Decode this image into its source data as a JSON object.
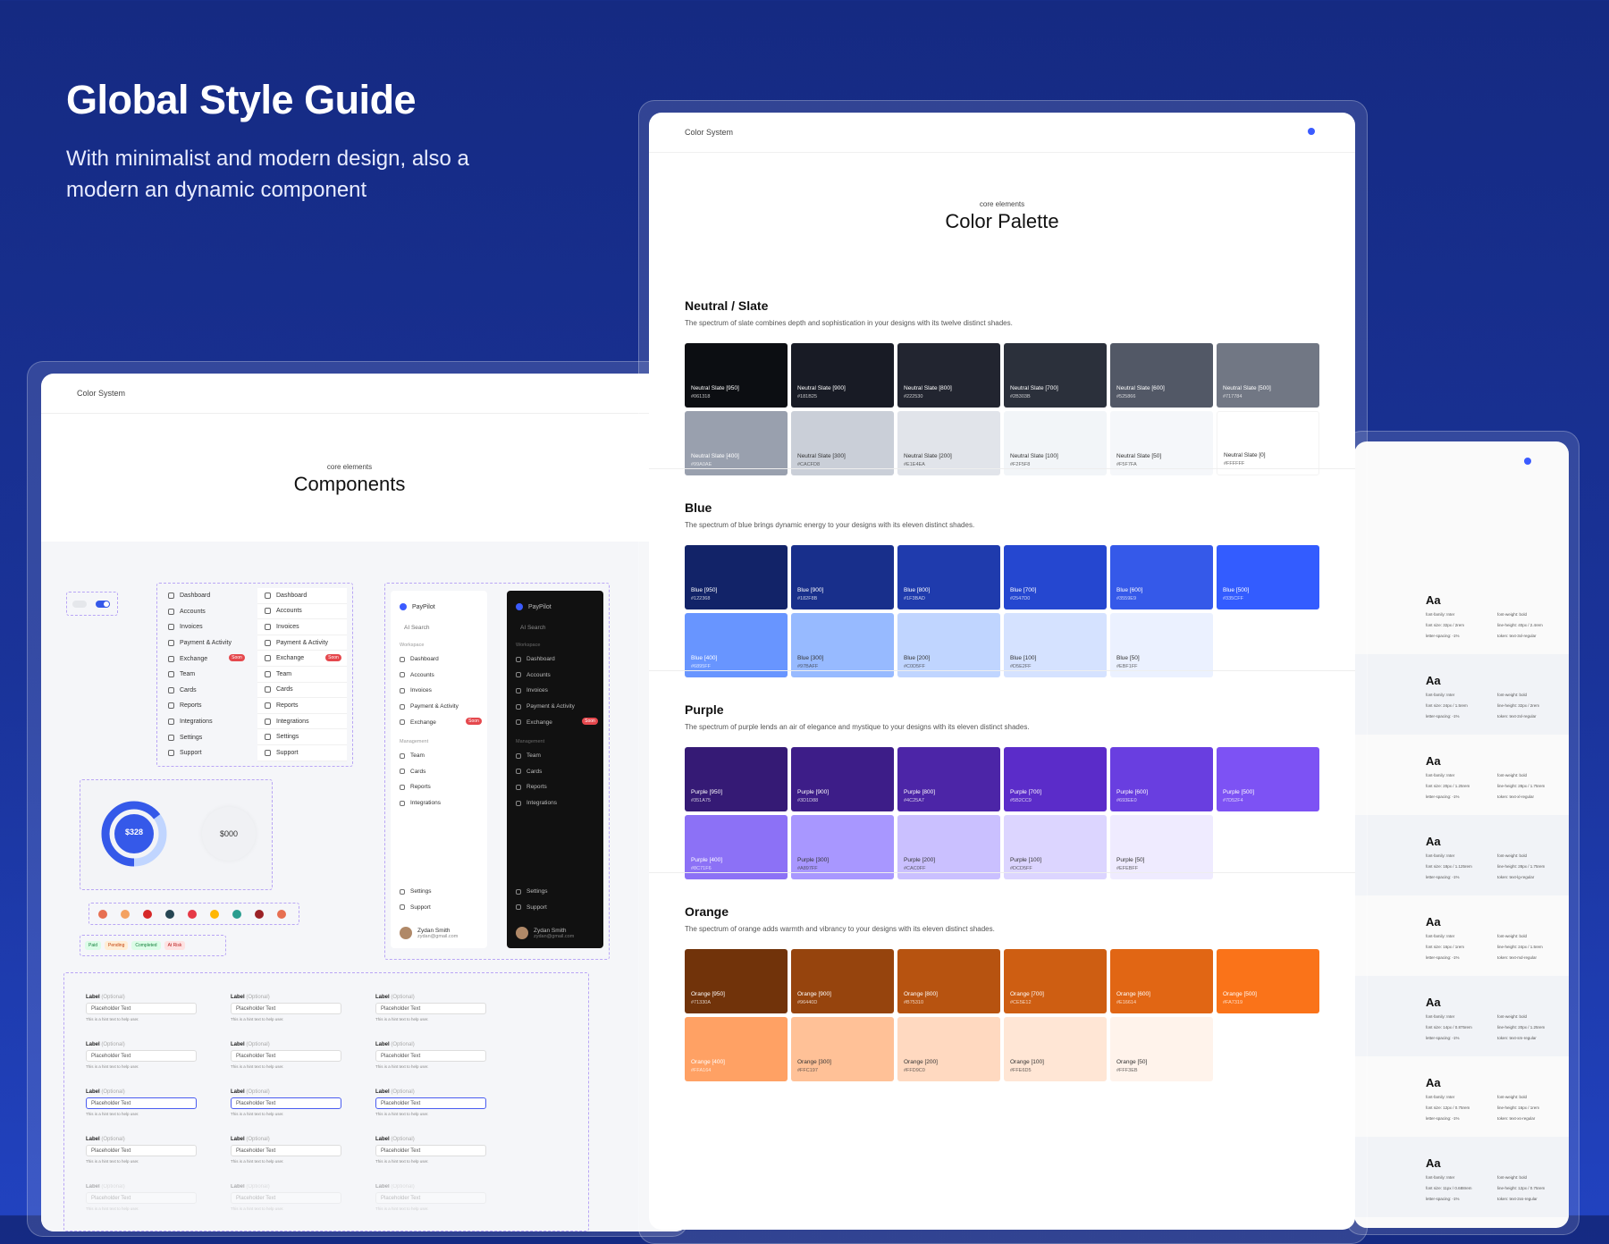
{
  "hero": {
    "title": "Global Style Guide",
    "subtitle": "With minimalist and modern design, also a modern an dynamic component"
  },
  "palette": {
    "system_label": "Color System",
    "eyebrow": "core elements",
    "title": "Color Palette",
    "sections": [
      {
        "title": "Neutral / Slate",
        "desc": "The spectrum of slate combines depth and sophistication in your designs with its twelve distinct shades.",
        "swatches": [
          {
            "n": "Neutral Slate [950]",
            "h": "#061318",
            "c": "#0c0e12",
            "t": "#fff"
          },
          {
            "n": "Neutral Slate [900]",
            "h": "#181B25",
            "c": "#181b25",
            "t": "#fff"
          },
          {
            "n": "Neutral Slate [800]",
            "h": "#222530",
            "c": "#222530",
            "t": "#fff"
          },
          {
            "n": "Neutral Slate [700]",
            "h": "#2B303B",
            "c": "#2b303b",
            "t": "#fff"
          },
          {
            "n": "Neutral Slate [600]",
            "h": "#525866",
            "c": "#525866",
            "t": "#fff"
          },
          {
            "n": "Neutral Slate [500]",
            "h": "#717784",
            "c": "#717784",
            "t": "#fff"
          },
          {
            "n": "Neutral Slate [400]",
            "h": "#99A0AE",
            "c": "#99a0ae",
            "t": "#fff"
          },
          {
            "n": "Neutral Slate [300]",
            "h": "#CACFD8",
            "c": "#cacfd8",
            "t": "#333"
          },
          {
            "n": "Neutral Slate [200]",
            "h": "#E1E4EA",
            "c": "#e1e4ea",
            "t": "#333"
          },
          {
            "n": "Neutral Slate [100]",
            "h": "#F2F5F8",
            "c": "#f2f5f8",
            "t": "#333"
          },
          {
            "n": "Neutral Slate [50]",
            "h": "#F5F7FA",
            "c": "#f5f7fa",
            "t": "#333"
          },
          {
            "n": "Neutral Slate [0]",
            "h": "#FFFFFF",
            "c": "#ffffff",
            "t": "#333"
          }
        ]
      },
      {
        "title": "Blue",
        "desc": "The spectrum of blue brings dynamic energy to your designs with its eleven distinct shades.",
        "swatches": [
          {
            "n": "Blue [950]",
            "h": "#122368",
            "c": "#122368",
            "t": "#fff"
          },
          {
            "n": "Blue [900]",
            "h": "#182F8B",
            "c": "#182f8b",
            "t": "#fff"
          },
          {
            "n": "Blue [800]",
            "h": "#1F3BAD",
            "c": "#1f3bad",
            "t": "#fff"
          },
          {
            "n": "Blue [700]",
            "h": "#2547D0",
            "c": "#2547d0",
            "t": "#fff"
          },
          {
            "n": "Blue [600]",
            "h": "#3559E9",
            "c": "#3559e9",
            "t": "#fff"
          },
          {
            "n": "Blue [500]",
            "h": "#335CFF",
            "c": "#335cff",
            "t": "#fff"
          },
          {
            "n": "Blue [400]",
            "h": "#6895FF",
            "c": "#6895ff",
            "t": "#fff"
          },
          {
            "n": "Blue [300]",
            "h": "#97BAFF",
            "c": "#97baff",
            "t": "#333"
          },
          {
            "n": "Blue [200]",
            "h": "#C0D5FF",
            "c": "#c0d5ff",
            "t": "#333"
          },
          {
            "n": "Blue [100]",
            "h": "#D5E2FF",
            "c": "#d5e2ff",
            "t": "#333"
          },
          {
            "n": "Blue [50]",
            "h": "#EBF1FF",
            "c": "#ebf1ff",
            "t": "#333"
          }
        ]
      },
      {
        "title": "Purple",
        "desc": "The spectrum of purple lends an air of elegance and mystique to your designs with its eleven distinct shades.",
        "swatches": [
          {
            "n": "Purple [950]",
            "h": "#351A75",
            "c": "#351a75",
            "t": "#fff"
          },
          {
            "n": "Purple [900]",
            "h": "#3D1D88",
            "c": "#3d1d88",
            "t": "#fff"
          },
          {
            "n": "Purple [800]",
            "h": "#4C25A7",
            "c": "#4c25a7",
            "t": "#fff"
          },
          {
            "n": "Purple [700]",
            "h": "#5B2CC9",
            "c": "#5b2cc9",
            "t": "#fff"
          },
          {
            "n": "Purple [600]",
            "h": "#693EE0",
            "c": "#693ee0",
            "t": "#fff"
          },
          {
            "n": "Purple [500]",
            "h": "#7D52F4",
            "c": "#7d52f4",
            "t": "#fff"
          },
          {
            "n": "Purple [400]",
            "h": "#8C71F6",
            "c": "#8c71f6",
            "t": "#fff"
          },
          {
            "n": "Purple [300]",
            "h": "#A897FF",
            "c": "#a897ff",
            "t": "#333"
          },
          {
            "n": "Purple [200]",
            "h": "#CAC0FF",
            "c": "#cac0ff",
            "t": "#333"
          },
          {
            "n": "Purple [100]",
            "h": "#DCD5FF",
            "c": "#dcd5ff",
            "t": "#333"
          },
          {
            "n": "Purple [50]",
            "h": "#EFEBFF",
            "c": "#efebff",
            "t": "#333"
          }
        ]
      },
      {
        "title": "Orange",
        "desc": "The spectrum of orange adds warmth and vibrancy to your designs with its eleven distinct shades.",
        "swatches": [
          {
            "n": "Orange [950]",
            "h": "#71330A",
            "c": "#71330a",
            "t": "#fff"
          },
          {
            "n": "Orange [900]",
            "h": "#96440D",
            "c": "#96440d",
            "t": "#fff"
          },
          {
            "n": "Orange [800]",
            "h": "#B75310",
            "c": "#b75310",
            "t": "#fff"
          },
          {
            "n": "Orange [700]",
            "h": "#CE5E12",
            "c": "#ce5e12",
            "t": "#fff"
          },
          {
            "n": "Orange [600]",
            "h": "#E16614",
            "c": "#e16614",
            "t": "#fff"
          },
          {
            "n": "Orange [500]",
            "h": "#FA7319",
            "c": "#fa7319",
            "t": "#fff"
          },
          {
            "n": "Orange [400]",
            "h": "#FFA164",
            "c": "#ffa164",
            "t": "#fff"
          },
          {
            "n": "Orange [300]",
            "h": "#FFC197",
            "c": "#ffc197",
            "t": "#333"
          },
          {
            "n": "Orange [200]",
            "h": "#FFD9C0",
            "c": "#ffd9c0",
            "t": "#333"
          },
          {
            "n": "Orange [100]",
            "h": "#FFE6D5",
            "c": "#ffe6d5",
            "t": "#333"
          },
          {
            "n": "Orange [50]",
            "h": "#FFF3EB",
            "c": "#fff3eb",
            "t": "#333"
          }
        ]
      }
    ]
  },
  "components": {
    "system_label": "Color System",
    "eyebrow": "core elements",
    "title": "Components",
    "menu": [
      "Dashboard",
      "Accounts",
      "Invoices",
      "Payment & Activity",
      "Exchange",
      "Team",
      "Cards",
      "Reports",
      "Integrations",
      "Settings",
      "Support"
    ],
    "menu_badge": "Soon",
    "donut_value": "$328",
    "donut_value2": "$000",
    "status": [
      "Paid",
      "Pending",
      "Completed",
      "At Risk"
    ],
    "sidebar": {
      "brand": "PayPilot",
      "search": "AI Search",
      "workspace": "Workspace",
      "management": "Management",
      "workspace_items": [
        "Dashboard",
        "Accounts",
        "Invoices",
        "Payment & Activity",
        "Exchange"
      ],
      "management_items": [
        "Team",
        "Cards",
        "Reports",
        "Integrations"
      ],
      "bottom_items": [
        "Settings",
        "Support"
      ],
      "user_name": "Zydan Smith",
      "user_email": "zydan@gmail.com"
    },
    "field": {
      "label": "Label",
      "optional": "(Optional)",
      "placeholder": "Placeholder Text",
      "hint": "This is a hint text to help user."
    }
  },
  "type": {
    "sample": "Aa",
    "rows": [
      {
        "fam": "font-family: Inter",
        "wt": "font-weight: bold",
        "sz": "font size: 32px / 2rem",
        "lh": "line-height: 40px / 2.4rem",
        "ls": "letter-spacing: -1%",
        "tk": "token: text-3xl-regular"
      },
      {
        "fam": "font-family: Inter",
        "wt": "font-weight: bold",
        "sz": "font size: 24px / 1.5rem",
        "lh": "line-height: 32px / 2rem",
        "ls": "letter-spacing: -1%",
        "tk": "token: text-2xl-regular"
      },
      {
        "fam": "font-family: Inter",
        "wt": "font-weight: bold",
        "sz": "font size: 20px / 1.25rem",
        "lh": "line-height: 28px / 1.75rem",
        "ls": "letter-spacing: -1%",
        "tk": "token: text-xl-regular"
      },
      {
        "fam": "font-family: Inter",
        "wt": "font-weight: bold",
        "sz": "font size: 18px / 1.125rem",
        "lh": "line-height: 28px / 1.75rem",
        "ls": "letter-spacing: -1%",
        "tk": "token: text-lg-regular"
      },
      {
        "fam": "font-family: Inter",
        "wt": "font-weight: bold",
        "sz": "font size: 16px / 1rem",
        "lh": "line-height: 24px / 1.5rem",
        "ls": "letter-spacing: -1%",
        "tk": "token: text-md-regular"
      },
      {
        "fam": "font-family: Inter",
        "wt": "font-weight: bold",
        "sz": "font size: 14px / 0.875rem",
        "lh": "line-height: 20px / 1.25rem",
        "ls": "letter-spacing: -1%",
        "tk": "token: text-sm-regular"
      },
      {
        "fam": "font-family: Inter",
        "wt": "font-weight: bold",
        "sz": "font size: 12px / 0.75rem",
        "lh": "line-height: 16px / 1rem",
        "ls": "letter-spacing: -1%",
        "tk": "token: text-xs-regular"
      },
      {
        "fam": "font-family: Inter",
        "wt": "font-weight: bold",
        "sz": "font size: 11px / 0.688rem",
        "lh": "line-height: 12px / 0.75rem",
        "ls": "letter-spacing: -1%",
        "tk": "token: text-2xs-regular"
      }
    ]
  }
}
